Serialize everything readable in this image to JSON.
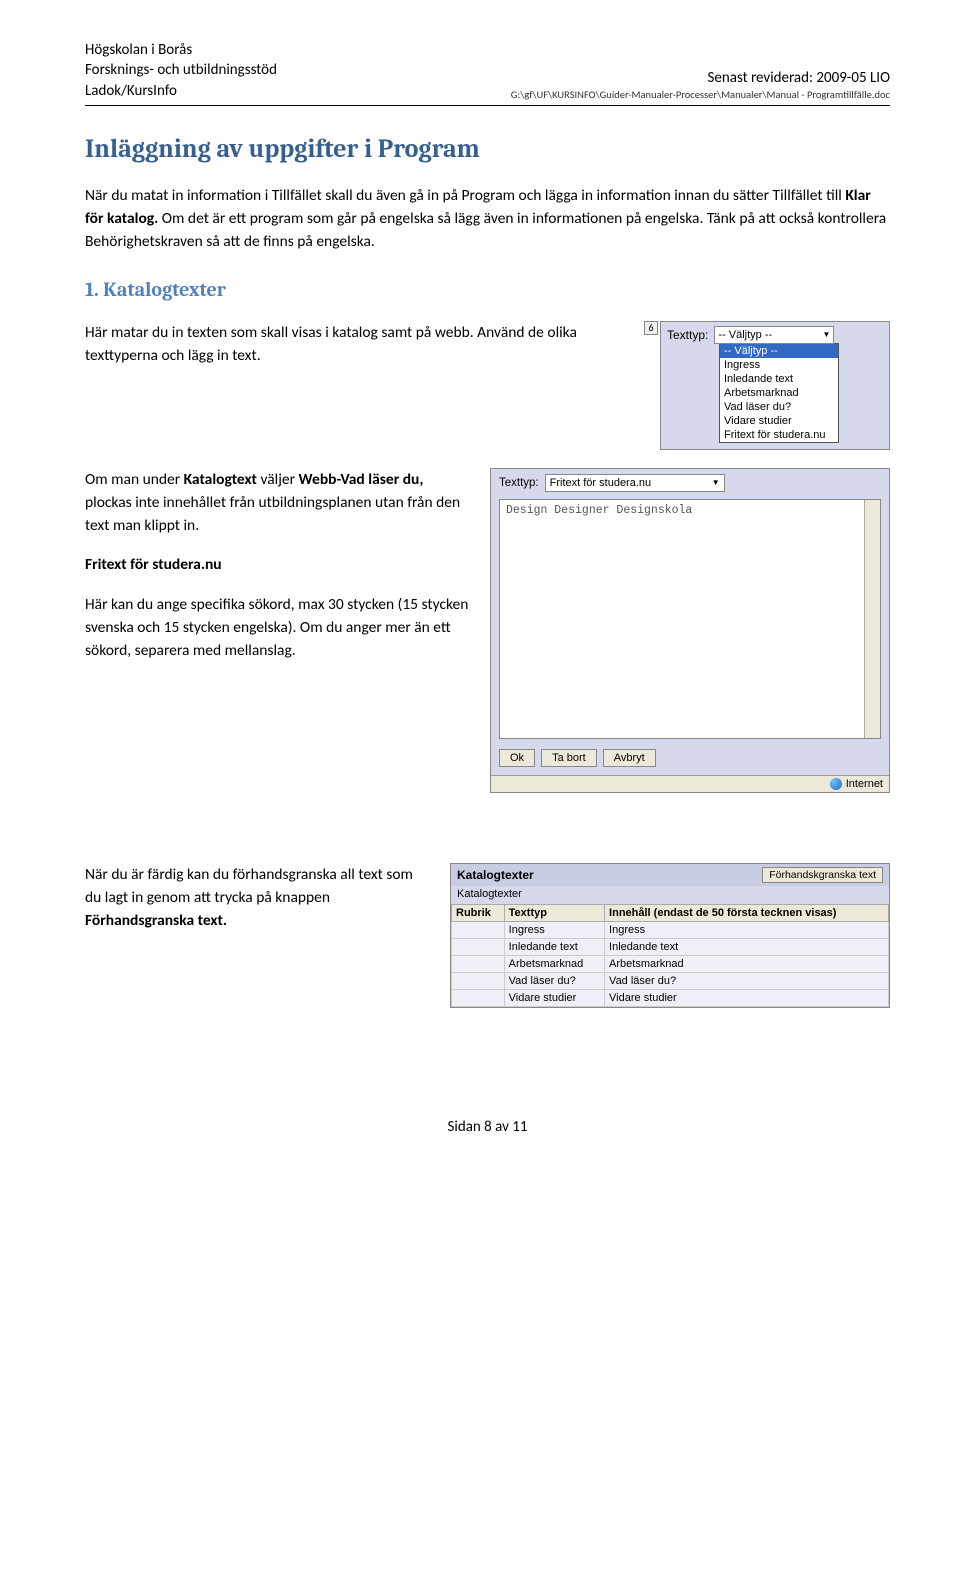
{
  "header": {
    "org1": "Högskolan i Borås",
    "org2": "Forsknings- och utbildningsstöd",
    "org3": "Ladok/KursInfo",
    "revised": "Senast reviderad: 2009-05 LIO",
    "path": "G:\\gf\\UF\\KURSINFO\\Guider-Manualer-Processer\\Manualer\\Manual - Programtillfälle.doc"
  },
  "title": "Inläggning av uppgifter i Program",
  "intro_pre": "När du matat in information i Tillfället skall du även gå in på Program och lägga in information innan du sätter Tillfället till ",
  "intro_bold": "Klar för katalog.",
  "intro_post": " Om det är ett program som går på engelska så lägg även in informationen på engelska. Tänk på att också kontrollera Behörighetskraven så att de finns på engelska.",
  "subhead1": "1. Katalogtexter",
  "p2": "Här matar du in texten som skall visas i katalog samt på webb. Använd de olika texttyperna och lägg in text.",
  "p3_pre": "Om man under ",
  "p3_b1": "Katalogtext",
  "p3_mid1": " väljer ",
  "p3_b2": "Webb-Vad läser du,",
  "p3_post": " plockas inte innehållet från utbildningsplanen utan från den text man klippt in.",
  "p4_bold": "Fritext för studera.nu",
  "p5": "Här kan du ange specifika sökord, max 30 stycken (15 stycken svenska och 15 stycken engelska). Om du anger mer än ett sökord, separera med mellanslag.",
  "p6_pre": "När du är färdig kan du förhandsgranska all text som du lagt in genom att trycka på knappen ",
  "p6_bold": "Förhandsgranska text.",
  "footer": "Sidan 8 av 11",
  "shot1": {
    "num": "6",
    "label": "Texttyp:",
    "selected": "-- Väljtyp --",
    "options": [
      "-- Väljtyp --",
      "Ingress",
      "Inledande text",
      "Arbetsmarknad",
      "Vad läser du?",
      "Vidare studier",
      "Fritext för studera.nu"
    ]
  },
  "shot2": {
    "label": "Texttyp:",
    "selected": "Fritext för studera.nu",
    "textarea": "Design Designer Designskola",
    "btn_ok": "Ok",
    "btn_del": "Ta bort",
    "btn_cancel": "Avbryt",
    "status": "Internet"
  },
  "shot3": {
    "header": "Katalogtexter",
    "preview_btn": "Förhandskgranska text",
    "sub": "Katalogtexter",
    "col_rubrik": "Rubrik",
    "col_texttyp": "Texttyp",
    "col_innehall": "Innehåll (endast de 50 första tecknen visas)",
    "rows": [
      {
        "t": "Ingress",
        "i": "Ingress"
      },
      {
        "t": "Inledande text",
        "i": "Inledande text"
      },
      {
        "t": "Arbetsmarknad",
        "i": "Arbetsmarknad"
      },
      {
        "t": "Vad läser du?",
        "i": "Vad läser du?"
      },
      {
        "t": "Vidare studier",
        "i": "Vidare studier"
      }
    ]
  }
}
